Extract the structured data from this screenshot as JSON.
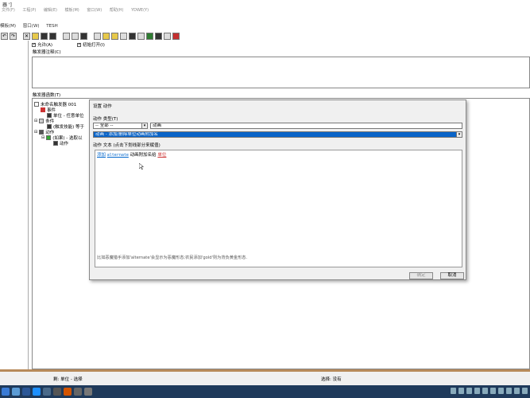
{
  "title": "器 ']",
  "menubar_faded": [
    "文件(F)",
    "工程(P)",
    "编辑(E)",
    "模板(M)",
    "窗口(W)",
    "帮助(H)",
    "YDWE(Y)"
  ],
  "menubar": [
    "模板(M)",
    "窗口(W)",
    "TESH"
  ],
  "toolbar_icons": [
    "undo-icon",
    "redo-icon",
    "cut-icon",
    "new-trigger-icon",
    "new-folder-icon",
    "new-var-icon",
    "event-icon",
    "condition-icon",
    "action-icon",
    "terrain-icon",
    "unit-icon",
    "trigger-icon",
    "sound-icon",
    "object-icon",
    "campaign-icon",
    "ai-icon",
    "import-icon",
    "test-map-icon"
  ],
  "trigger_props": {
    "enable_label": "允许(A)",
    "enable_checked": true,
    "initially_on_label": "初始打开(I)",
    "initially_on_checked": true,
    "comment_label": "触发器注释(C)",
    "functions_label": "触发器函数(T)"
  },
  "tree": {
    "root": "未命名触发器 001",
    "event_label": "事件",
    "event_item": "单位 - 任意单位",
    "condition_label": "条件",
    "condition_item": "(触发技能) 等于",
    "action_label": "动作",
    "action_if": "(如果) - 选取以",
    "action_sub": "动作"
  },
  "dialog": {
    "title": "设置 动作",
    "type_label": "动作 类型(T)",
    "type_value": "-- 全部 --",
    "search_value": "动画",
    "action_value": "动画 - 添加/删除单位动画附加名",
    "text_label": "动作 文本 (点击下划线部分来赋值)",
    "text_parts": {
      "p1": "添加",
      "p2": "alternate",
      "p3": "动画附加名给",
      "p4": "单位"
    },
    "hint": "比如恶魔猎手添加'alternate'会显示为恶魔形态;农民添加'gold'则为背负黄金形态.",
    "ok_label": "确定",
    "cancel_label": "取消"
  },
  "statusbar": {
    "left_label": "剩",
    "left_text": "单位 - 选择",
    "right_label": "选择",
    "right_text": "没有"
  },
  "accent": "#0a64c8",
  "taskbar_color": "#1f3a5b"
}
